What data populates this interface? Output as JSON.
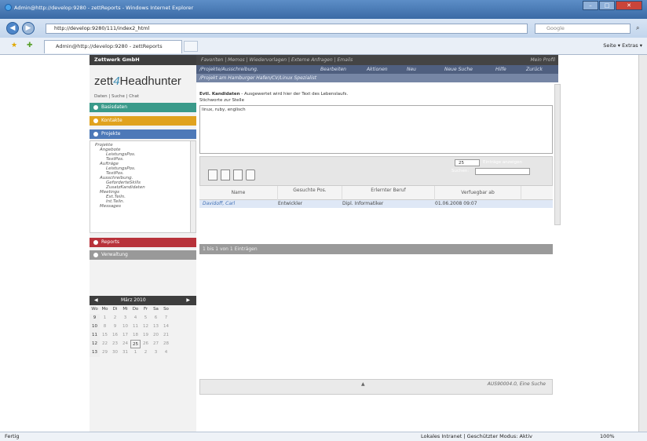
{
  "window": {
    "title": "Admin@http://develop:9280 - zettReports - Windows Internet Explorer",
    "address": "http://develop:9280/111/index2_html",
    "search_placeholder": "Google",
    "tab_title": "Admin@http://develop:9280 - zettReports",
    "cmd": "Seite ▾  Extras ▾",
    "status_left": "Fertig",
    "status_zone": "Lokales Intranet | Geschützter Modus: Aktiv",
    "zoom": "100%"
  },
  "app": {
    "company": "Zettwerk GmbH",
    "logo_a": "zett",
    "logo_b": "4",
    "logo_c": "Headhunter",
    "submenu": "Daten | Suche | Chat",
    "topnav": "Favoriten | Memos | Wiedervorlagen | Externe Anfragen | Emails",
    "topnav_right": "Mein Profil",
    "accordion": [
      "Basisdaten",
      "Kontakte",
      "Projekte",
      "Reports",
      "Verwaltung"
    ],
    "tree": [
      "Projekte",
      "Angebote",
      "LeistungsPos.",
      "TextPos.",
      "Aufträge",
      "LeistungsPos.",
      "TextPos.",
      "Ausschreibung.",
      "GeforderteSkills",
      "ZusatzKandidaten",
      "Meetings",
      "Ext.Teiln.",
      "Int.Teiln.",
      "Messages"
    ],
    "calendar": {
      "month": "März 2010",
      "header": [
        "Wo",
        "Mo",
        "Di",
        "Mi",
        "Do",
        "Fr",
        "Sa",
        "So"
      ],
      "rows": [
        [
          "9",
          "1",
          "2",
          "3",
          "4",
          "5",
          "6",
          "7"
        ],
        [
          "10",
          "8",
          "9",
          "10",
          "11",
          "12",
          "13",
          "14"
        ],
        [
          "11",
          "15",
          "16",
          "17",
          "18",
          "19",
          "20",
          "21"
        ],
        [
          "12",
          "22",
          "23",
          "24",
          "25",
          "26",
          "27",
          "28"
        ],
        [
          "13",
          "29",
          "30",
          "31",
          "1",
          "2",
          "3",
          "4"
        ]
      ]
    },
    "breadcrumb": "/Projekte/Ausschreibung.",
    "menu": [
      "Bearbeiten",
      "Aktionen",
      "Neu",
      "Neue Suche",
      "Hilfe",
      "Zurück"
    ],
    "subtitle": "/Projekt am Hamburger Hafen/CV/Linux Spezialist",
    "section_bold": "Evtl. Kandidaten",
    "section_text": " - Ausgewertet wird hier der Text des Lebenslaufs.",
    "keywords_label": "Stichworte zur Stelle",
    "keywords": "linux, ruby, englisch",
    "page_size": "25",
    "page_size_label": "Einträge anzeigen",
    "search_label": "Suchen:",
    "columns": [
      "Name",
      "Gesuchte Pos.",
      "Erlernter Beruf",
      "Verfuegbar ab"
    ],
    "rows": [
      [
        "Davidoff, Carl",
        "Entwickler",
        "Dipl. Informatiker",
        "01.06.2008 09:07"
      ]
    ],
    "footer": "1 bis 1 von 1 Einträgen",
    "bottom_status": "AUS90004.0, Eine Suche"
  }
}
